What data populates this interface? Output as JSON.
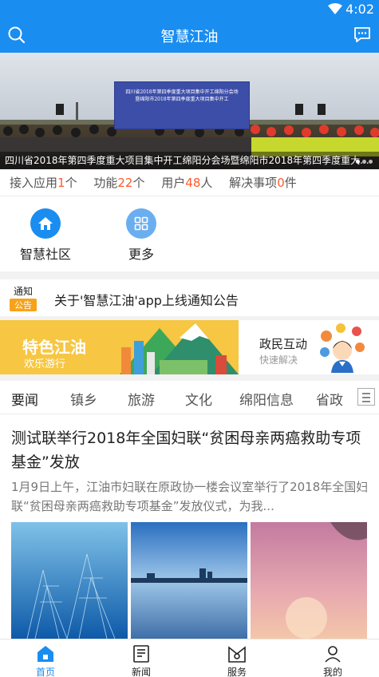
{
  "status_bar": {
    "time": "4:02"
  },
  "app_bar": {
    "title": "智慧江油"
  },
  "banner": {
    "caption": "四川省2018年第四季度重大项目集中开工绵阳分会场暨绵阳市2018年第四季度重大...",
    "board_text_line1": "四川省2018年第四季度重大项目集中开工绵阳分会场",
    "board_text_line2": "暨绵阳市2018年第四季度重大项目集中开工"
  },
  "stats": [
    {
      "label": "接入应用",
      "value": "1",
      "unit": "个"
    },
    {
      "label": "功能",
      "value": "22",
      "unit": "个"
    },
    {
      "label": "用户",
      "value": "48",
      "unit": "人"
    },
    {
      "label": "解决事项",
      "value": "0",
      "unit": "件"
    }
  ],
  "apps": [
    {
      "label": "智慧社区",
      "icon": "home-icon"
    },
    {
      "label": "更多",
      "icon": "grid-icon"
    }
  ],
  "notice": {
    "badge_top": "通知",
    "badge_bottom": "公告",
    "text": "关于'智慧江油'app上线通知公告"
  },
  "promo": {
    "left_title": "特色江油",
    "left_subtitle": "欢乐游行",
    "right_title": "政民互动",
    "right_subtitle": "快速解决"
  },
  "tabs": [
    "要闻",
    "镇乡",
    "旅游",
    "文化",
    "绵阳信息",
    "省政"
  ],
  "article": {
    "title": "测试联举行2018年全国妇联“贫困母亲两癌救助专项基金”发放",
    "summary": "1月9日上午，江油市妇联在原政协一楼会议室举行了2018年全国妇联“贫困母亲两癌救助专项基金”发放仪式，为我..."
  },
  "bottom_nav": [
    {
      "label": "首页",
      "icon": "home-nav-icon"
    },
    {
      "label": "新闻",
      "icon": "news-icon"
    },
    {
      "label": "服务",
      "icon": "service-icon"
    },
    {
      "label": "我的",
      "icon": "profile-icon"
    }
  ],
  "colors": {
    "primary": "#1a8df0",
    "highlight": "#ff5a2c",
    "notice_badge": "#f7a21b",
    "promo_yellow": "#f7c642"
  }
}
